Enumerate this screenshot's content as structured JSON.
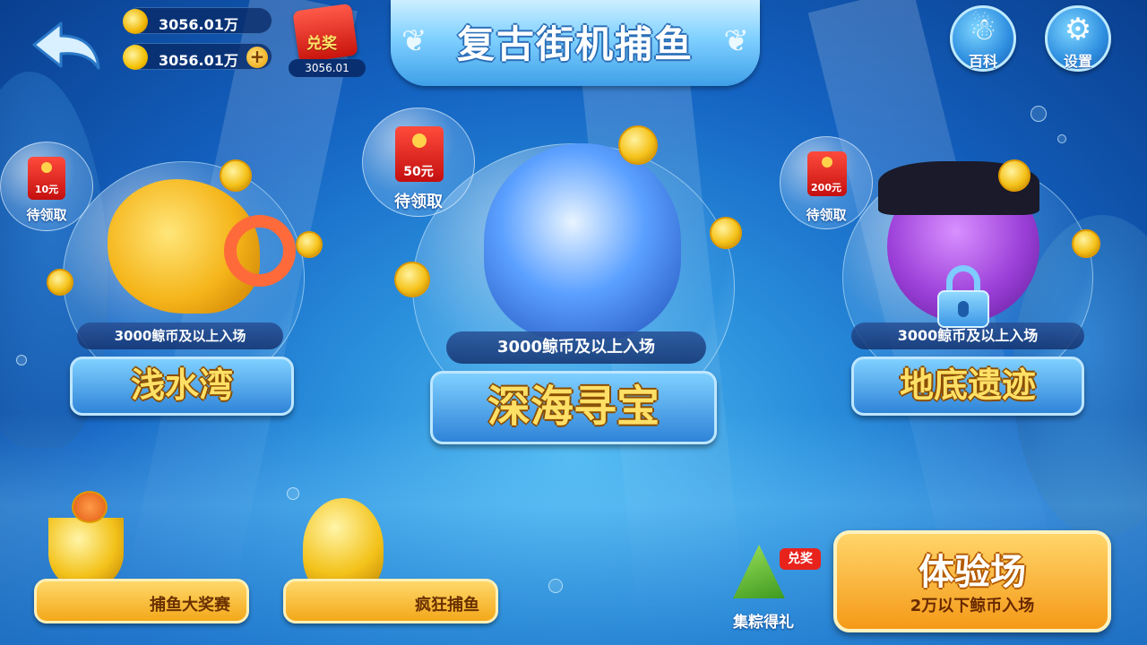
{
  "colors": {
    "accent_gold": "#ffe066",
    "ocean": "#1463c2",
    "red_packet": "#e8231c"
  },
  "topbar": {
    "fish_coins": "3056.01万",
    "gold_coins": "3056.01万",
    "redeem_label": "兑奖",
    "redeem_amount": "3056.01",
    "title": "复古街机捕鱼",
    "encyclopedia_label": "百科",
    "settings_label": "设置"
  },
  "rooms": [
    {
      "name": "浅水湾",
      "entry": "3000鲸币及以上入场",
      "reward_amount": "10元",
      "reward_claim": "待领取",
      "locked": false
    },
    {
      "name": "深海寻宝",
      "entry": "3000鲸币及以上入场",
      "reward_amount": "50元",
      "reward_claim": "待领取",
      "locked": false
    },
    {
      "name": "地底遗迹",
      "entry": "3000鲸币及以上入场",
      "reward_amount": "200元",
      "reward_claim": "待领取",
      "locked": true
    }
  ],
  "bottom": {
    "tournament_label": "捕鱼大奖赛",
    "crazy_label": "疯狂捕鱼",
    "zongzi_badge": "兑奖",
    "zongzi_label": "集粽得礼",
    "trial_title": "体验场",
    "trial_subtitle": "2万以下鲸币入场"
  }
}
